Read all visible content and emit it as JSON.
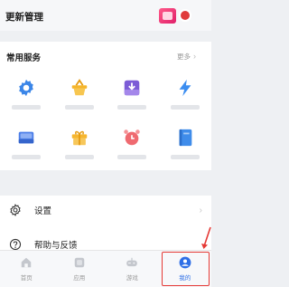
{
  "header": {
    "title": "更新管理"
  },
  "services": {
    "title": "常用服务",
    "more_label": "更多",
    "items": [
      {
        "label": "",
        "icon": "gear-icon",
        "color": "#3b86e8"
      },
      {
        "label": "",
        "icon": "basket-icon",
        "color": "#f5b52a"
      },
      {
        "label": "",
        "icon": "download-box-icon",
        "color": "#7c5cd6"
      },
      {
        "label": "",
        "icon": "lightning-icon",
        "color": "#3b8df0"
      },
      {
        "label": "",
        "icon": "tray-icon",
        "color": "#4b7ee8"
      },
      {
        "label": "",
        "icon": "gift-icon",
        "color": "#f6b62f"
      },
      {
        "label": "",
        "icon": "alarm-icon",
        "color": "#ef6a70"
      },
      {
        "label": "",
        "icon": "book-icon",
        "color": "#3f8cea"
      }
    ]
  },
  "settings": {
    "items": [
      {
        "label": "设置",
        "icon": "settings-icon"
      },
      {
        "label": "帮助与反馈",
        "icon": "help-icon"
      }
    ]
  },
  "nav": {
    "tabs": [
      {
        "label": "首页",
        "icon": "home-icon"
      },
      {
        "label": "应用",
        "icon": "apps-icon"
      },
      {
        "label": "游戏",
        "icon": "gamepad-icon"
      },
      {
        "label": "我的",
        "icon": "profile-icon",
        "active": true
      }
    ],
    "active_color": "#2f6fe6",
    "highlight_color": "#e53935"
  }
}
